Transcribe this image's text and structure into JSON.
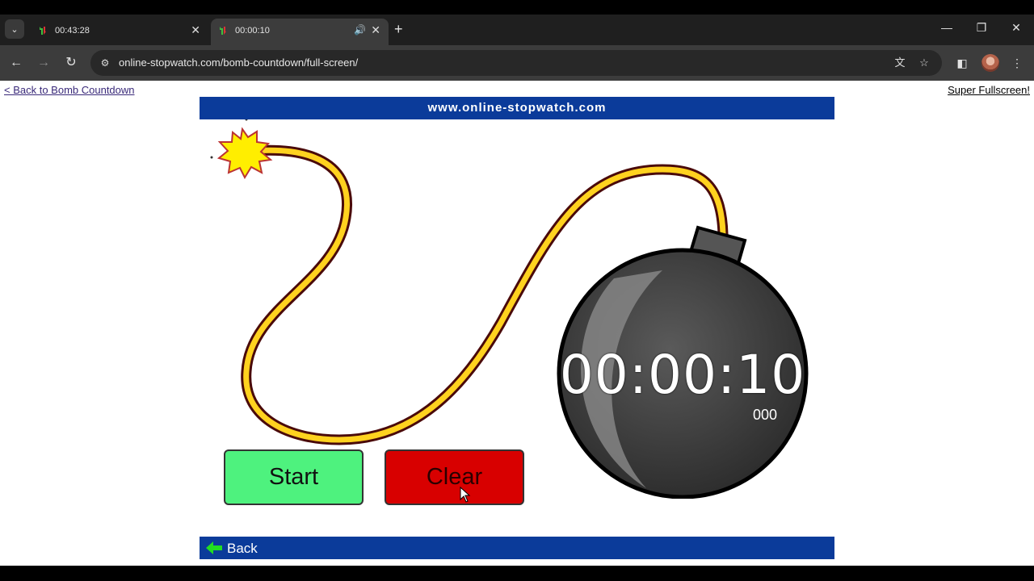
{
  "browser": {
    "tabs": [
      {
        "title": "00:43:28",
        "active": false
      },
      {
        "title": "00:00:10",
        "active": true
      }
    ],
    "url": "online-stopwatch.com/bomb-countdown/full-screen/"
  },
  "page": {
    "back_link": "< Back to Bomb Countdown",
    "super_fullscreen_link": "Super Fullscreen!",
    "site_banner": "www.online-stopwatch.com",
    "timer": "00:00:10",
    "millis": "000",
    "start_label": "Start",
    "clear_label": "Clear",
    "back_label": "Back"
  },
  "colors": {
    "banner": "#0b3b9a",
    "start": "#4ef27e",
    "clear": "#d80000"
  }
}
